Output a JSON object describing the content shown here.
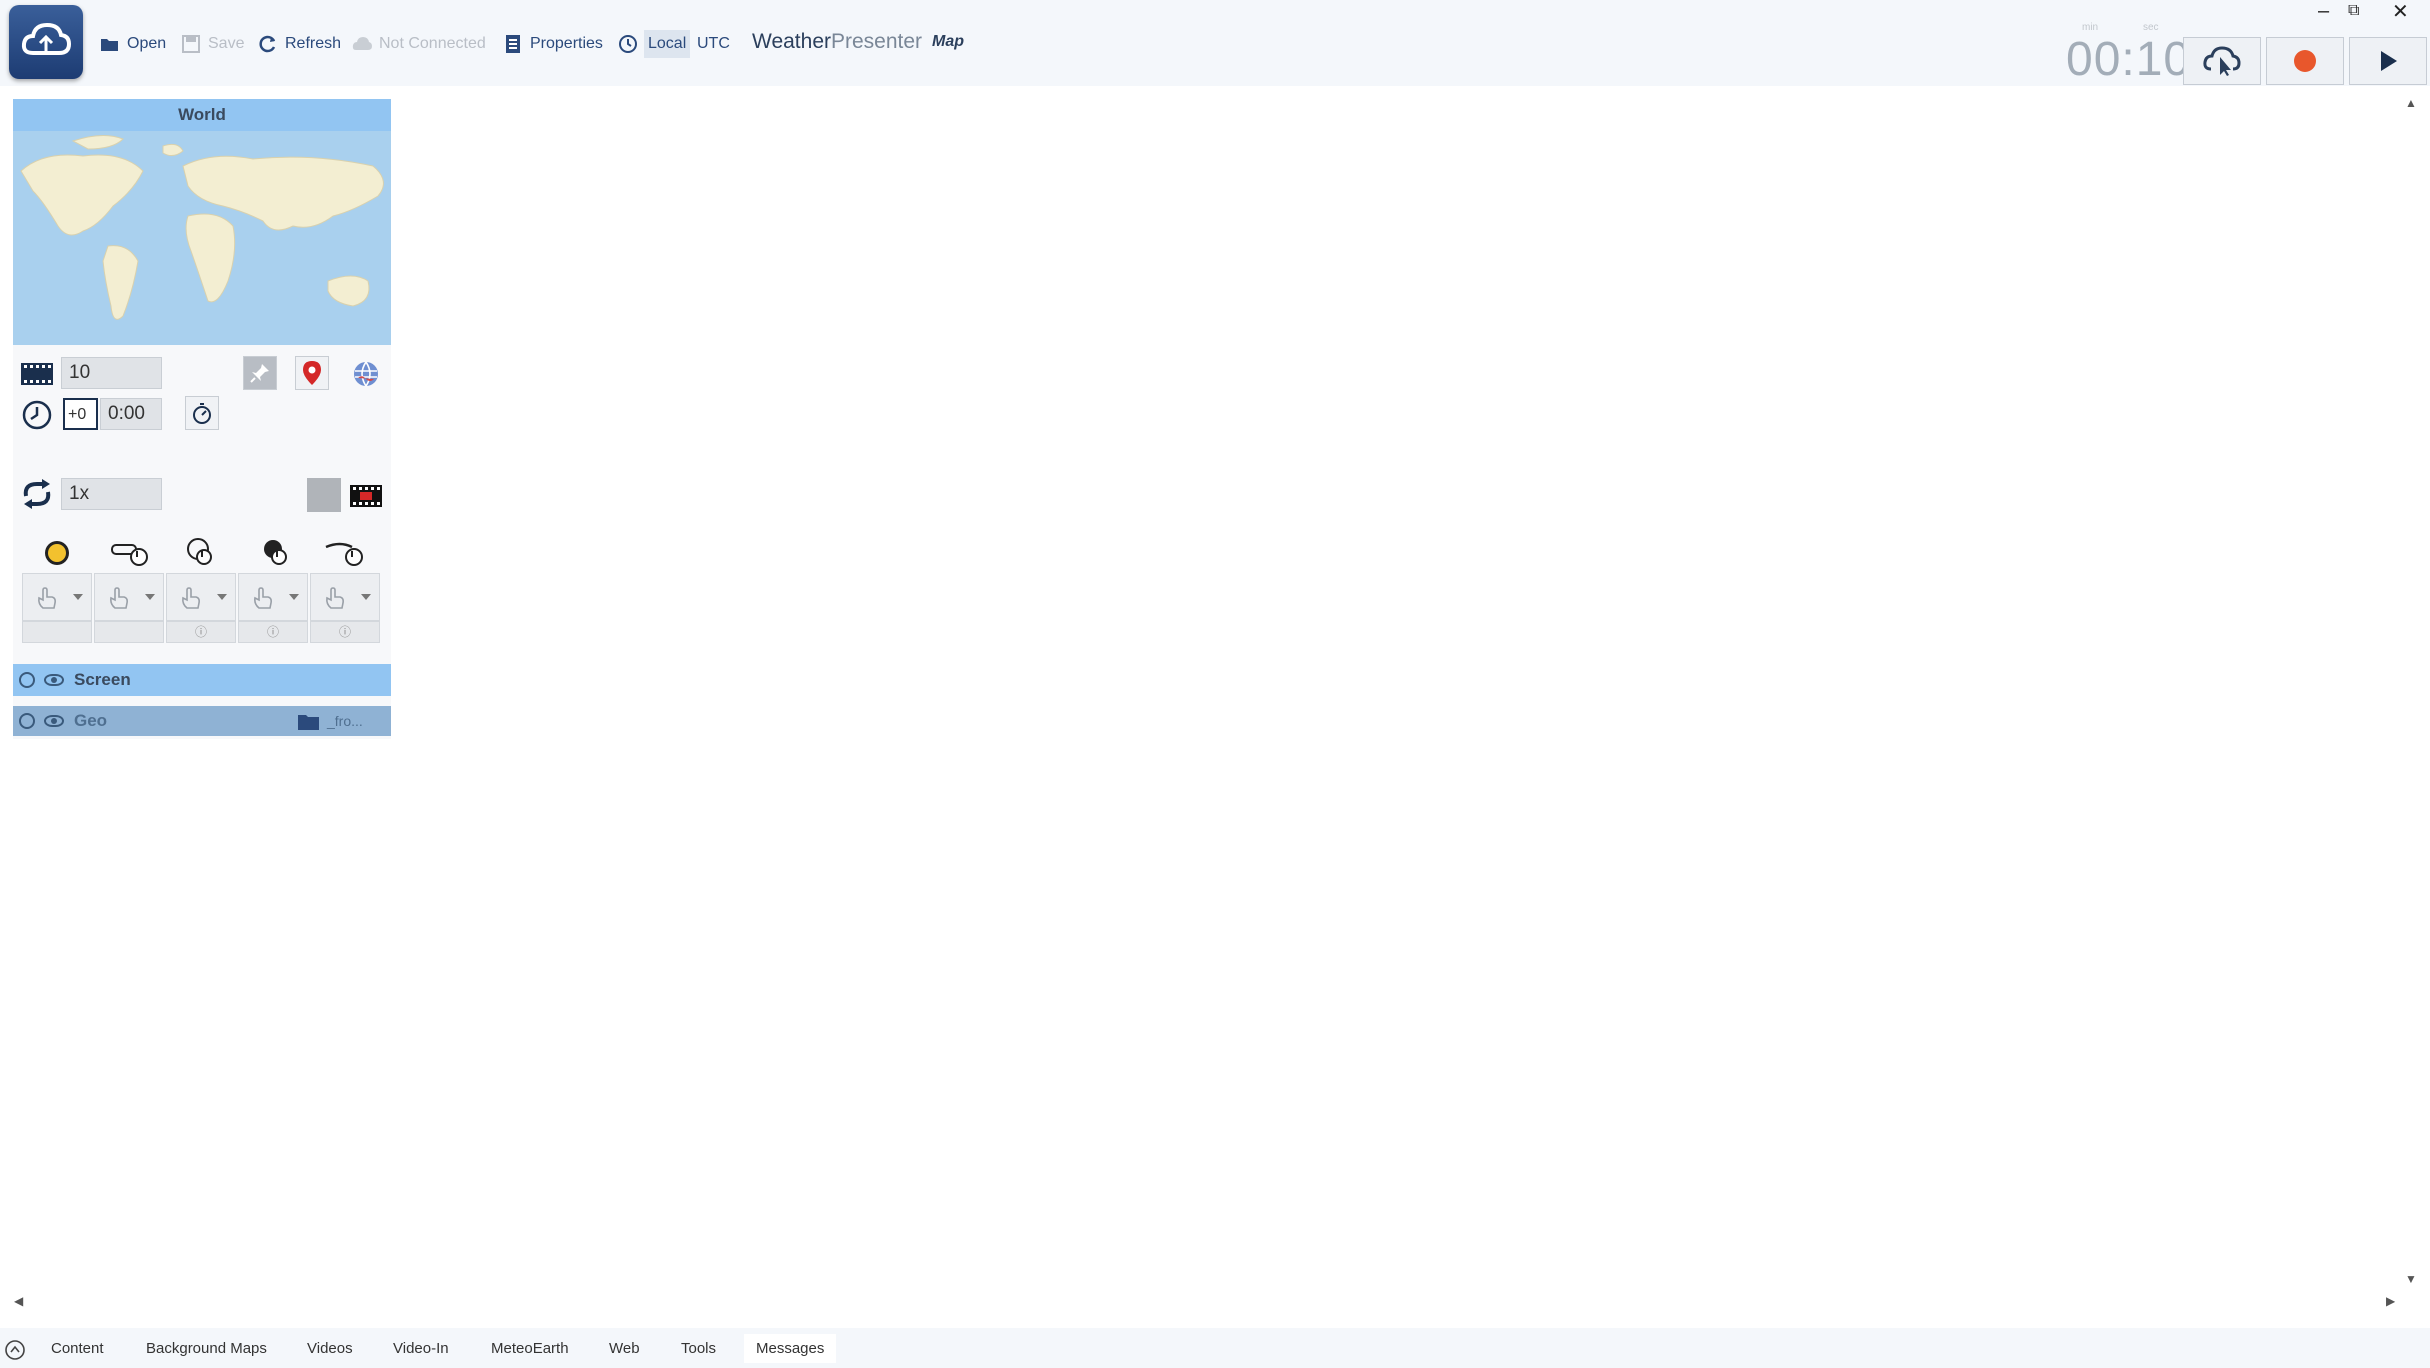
{
  "toolbar": {
    "open": "Open",
    "save": "Save",
    "refresh": "Refresh",
    "not_connected": "Not Connected",
    "properties": "Properties",
    "local": "Local",
    "utc": "UTC",
    "brand_bold": "Weather",
    "brand_light": "Presenter",
    "map": "Map"
  },
  "timer": {
    "min_label": "min",
    "sec_label": "sec",
    "value": "00:10"
  },
  "panel": {
    "title": "World",
    "frames_value": "10",
    "time_offset": "+0",
    "time_value": "0:00",
    "speed_value": "1x",
    "handrow_sub": [
      "",
      "",
      "ⓘ",
      "ⓘ",
      "ⓘ"
    ]
  },
  "layers": {
    "screen": "Screen",
    "geo": "Geo",
    "geo_folder": "_fro..."
  },
  "tabs": [
    "Content",
    "Background Maps",
    "Videos",
    "Video-In",
    "MeteoEarth",
    "Web",
    "Tools",
    "Messages"
  ],
  "colors": {
    "accent": "#92c5f2",
    "record": "#e8572c",
    "brand": "#2b3f5c"
  }
}
